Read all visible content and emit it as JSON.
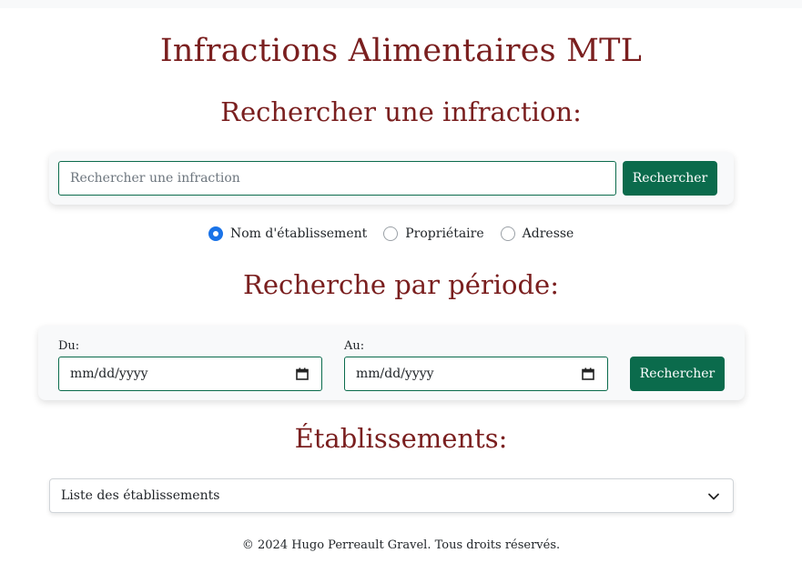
{
  "header": {
    "title": "Infractions Alimentaires MTL"
  },
  "search": {
    "heading": "Rechercher une infraction:",
    "placeholder": "Rechercher une infraction",
    "button_label": "Rechercher",
    "options": [
      {
        "label": "Nom d'établissement",
        "checked": true
      },
      {
        "label": "Propriétaire",
        "checked": false
      },
      {
        "label": "Adresse",
        "checked": false
      }
    ]
  },
  "period": {
    "heading": "Recherche par période:",
    "from_label": "Du:",
    "to_label": "Au:",
    "from_value": "mm/dd/yyyy",
    "to_value": "mm/dd/yyyy",
    "button_label": "Rechercher",
    "icon": "calendar-icon"
  },
  "establishments": {
    "heading": "Établissements:",
    "selected": "Liste des établissements",
    "icon": "chevron-down-icon"
  },
  "footer": {
    "text": "© 2024 Hugo Perreault Gravel. Tous droits réservés."
  },
  "colors": {
    "title": "#7a1f1f",
    "accent": "#0b6b4c",
    "radio": "#1a73e8"
  }
}
